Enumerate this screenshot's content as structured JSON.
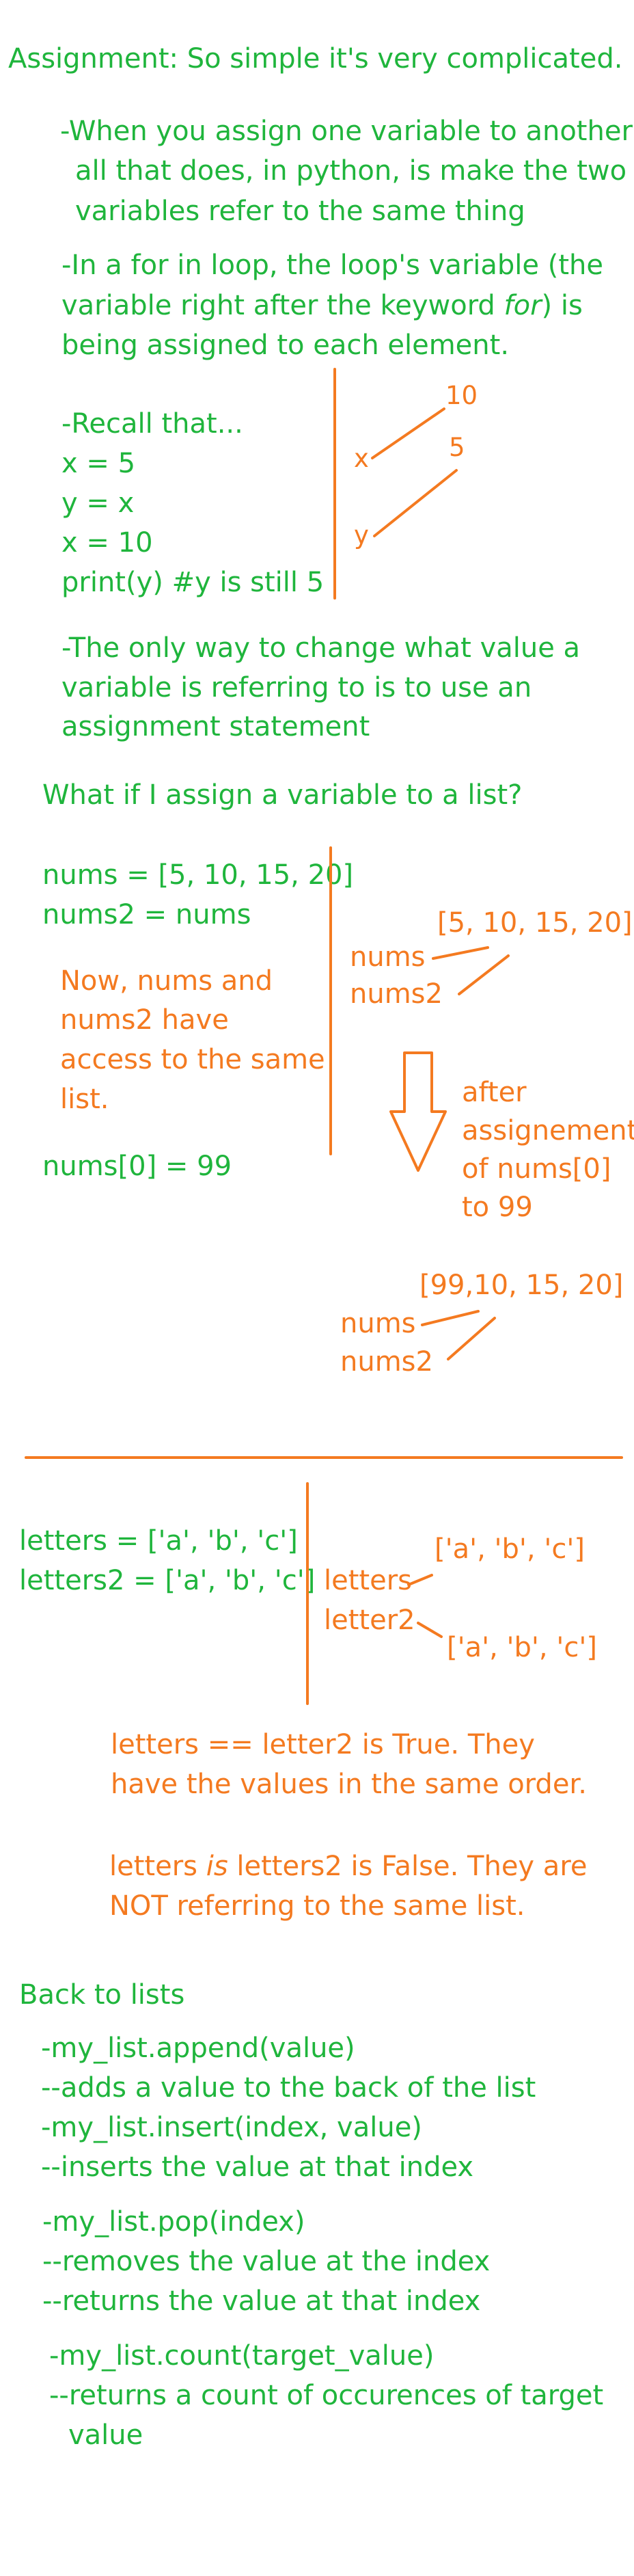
{
  "title": "Assignment: So simple it's very complicated.",
  "note1": {
    "line1": "-When you assign one variable to another",
    "line2": "all that does, in python, is make the two",
    "line3": "variables refer to the same thing"
  },
  "note2": {
    "line1": "-In a for in loop, the loop's variable (the",
    "line2_a": "variable right after the keyword ",
    "line2_kw": "for",
    "line2_b": ") is",
    "line3": "being assigned to each element."
  },
  "recall": {
    "heading": "-Recall that...",
    "code1": "x = 5",
    "code2": "y = x",
    "code3": "x = 10",
    "code4": "print(y)  #y is still 5"
  },
  "diagram1": {
    "val_top": "10",
    "val_bottom": "5",
    "var_x": "x",
    "var_y": "y"
  },
  "note3": {
    "line1": "-The only way to change what value a",
    "line2": "variable is referring to is to use an",
    "line3": "assignment statement"
  },
  "question": "What if I assign a variable to a list?",
  "list_section": {
    "code1": "nums = [5, 10, 15, 20]",
    "code2": "nums2 = nums",
    "explain1": "Now, nums and",
    "explain2": "nums2 have",
    "explain3": "access to the same",
    "explain4": "list.",
    "code3": "nums[0] = 99"
  },
  "diagram2": {
    "list_before": "[5, 10, 15, 20]",
    "var1": "nums",
    "var2": "nums2",
    "after1": "after",
    "after2": "assignement",
    "after3": "of nums[0]",
    "after4": "to 99",
    "list_after": "[99,10, 15, 20]",
    "var1_after": "nums",
    "var2_after": "nums2"
  },
  "letters_section": {
    "code1": "letters = ['a', 'b', 'c']",
    "code2": "letters2 = ['a', 'b', 'c']",
    "list_top": "['a', 'b', 'c']",
    "var1": "letters",
    "var2": "letter2",
    "list_bottom": "['a', 'b', 'c']",
    "eq1": "letters == letter2 is True. They",
    "eq2": "have the values in the same order.",
    "is1_a": "letters ",
    "is1_kw": "is",
    "is1_b": " letters2 is False. They are",
    "is2": "NOT referring to the same list."
  },
  "lists": {
    "heading": "Back to lists",
    "l1": "-my_list.append(value)",
    "l2": "--adds a value to the back of the list",
    "l3": "-my_list.insert(index, value)",
    "l4": "--inserts the value at that index",
    "l5": "-my_list.pop(index)",
    "l6": "--removes the value at the index",
    "l7": "--returns the value at that index",
    "l8": "-my_list.count(target_value)",
    "l9": "--returns a count of occurences of target",
    "l10": "value"
  },
  "colors": {
    "green": "#1fb53c",
    "orange": "#f47a20"
  }
}
